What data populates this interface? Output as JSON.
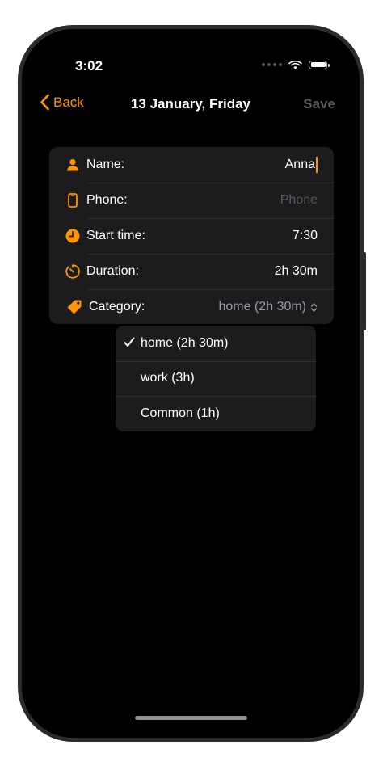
{
  "status_bar": {
    "time": "3:02"
  },
  "nav": {
    "back_label": "Back",
    "title": "13 January, Friday",
    "save_label": "Save"
  },
  "form": {
    "rows": [
      {
        "icon": "person-icon",
        "label": "Name:",
        "value": "Anna"
      },
      {
        "icon": "phone-icon",
        "label": "Phone:",
        "placeholder": "Phone"
      },
      {
        "icon": "clock-icon",
        "label": "Start time:",
        "value": "7:30"
      },
      {
        "icon": "timer-icon",
        "label": "Duration:",
        "value": "2h 30m"
      },
      {
        "icon": "tag-icon",
        "label": "Category:",
        "value": "home (2h 30m)"
      }
    ]
  },
  "dropdown": {
    "options": [
      {
        "label": "home (2h 30m)",
        "selected": true
      },
      {
        "label": "work (3h)",
        "selected": false
      },
      {
        "label": "Common (1h)",
        "selected": false
      }
    ]
  },
  "colors": {
    "accent": "#ff9500",
    "background": "#000000",
    "card": "#1c1c1e",
    "disabled": "#5c5c5e",
    "placeholder": "#5a5a5e"
  }
}
